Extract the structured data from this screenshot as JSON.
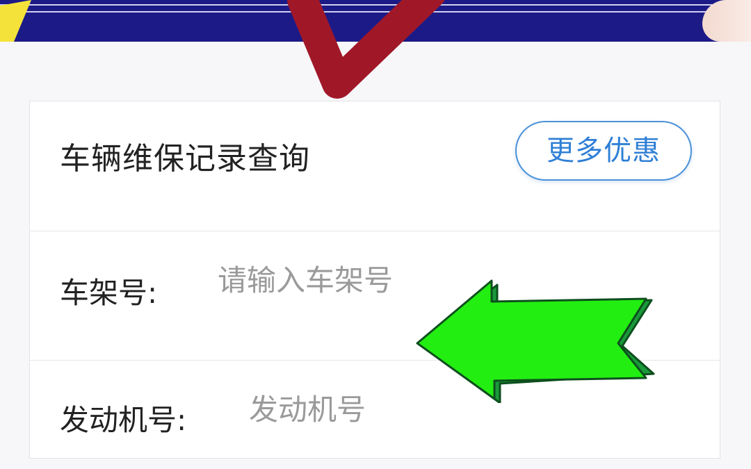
{
  "card": {
    "title": "车辆维保记录查询",
    "more_button_label": "更多优惠"
  },
  "form": {
    "vin": {
      "label": "车架号:",
      "placeholder": "请输入车架号",
      "value": ""
    },
    "engine": {
      "label": "发动机号:",
      "placeholder": "发动机号",
      "value": ""
    }
  },
  "overlays": {
    "checkmark_color": "#a01828",
    "arrow_color": "#22ee11",
    "arrow_edge_color": "#1a9a3a"
  },
  "theme": {
    "accent": "#2f7fd6",
    "banner_bg": "#1c1a86"
  }
}
